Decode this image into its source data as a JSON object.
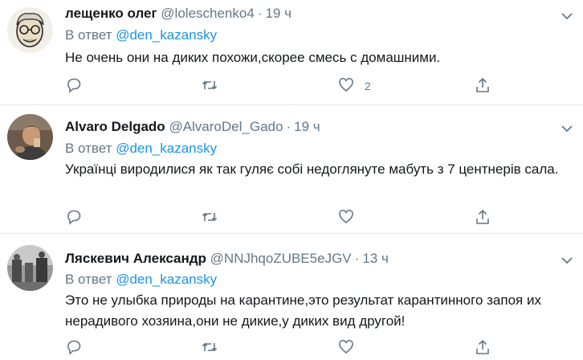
{
  "tweets": [
    {
      "name": "лещенко олег",
      "handle": "@loleschenko4",
      "dot": "·",
      "time": "19 ч",
      "reply_prefix": "В ответ",
      "reply_mention": "@den_kazansky",
      "text": "Не очень они на диких похожи,скорее смесь с домашними.",
      "like_count": "2"
    },
    {
      "name": "Alvaro Delgado",
      "handle": "@AlvaroDel_Gado",
      "dot": "·",
      "time": "19 ч",
      "reply_prefix": "В ответ",
      "reply_mention": "@den_kazansky",
      "text": "Українці виродилися як так гуляє собі недоглянуте мабуть з 7 центнерів сала.",
      "like_count": ""
    },
    {
      "name": "Ляскевич Александр",
      "handle": "@NNJhqoZUBE5eJGV",
      "dot": "·",
      "time": "13 ч",
      "reply_prefix": "В ответ",
      "reply_mention": "@den_kazansky",
      "text": "Это не улыбка природы на карантине,это результат карантинного запоя их нерадивого хозяина,они не дикие,у диких вид другой!",
      "like_count": ""
    }
  ],
  "icons": {
    "reply": "reply-icon",
    "retweet": "retweet-icon",
    "like": "heart-icon",
    "share": "share-icon",
    "more": "chevron-down-icon"
  },
  "colors": {
    "text": "#14171a",
    "secondary": "#657786",
    "mention": "#1b95e0",
    "divider": "#e1e8ed"
  }
}
